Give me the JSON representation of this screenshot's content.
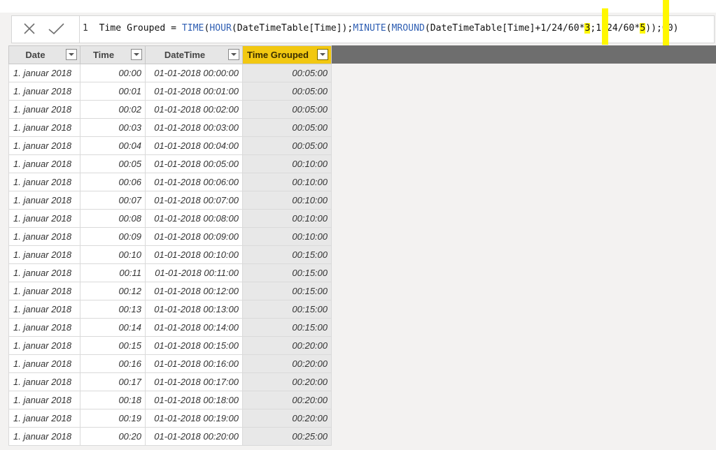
{
  "formula_bar": {
    "cancel_icon": "close-icon",
    "commit_icon": "check-icon",
    "line_number": "1",
    "parts": [
      {
        "text": "  Time Grouped = ",
        "kind": "plain"
      },
      {
        "text": "TIME",
        "kind": "fn"
      },
      {
        "text": "(",
        "kind": "plain"
      },
      {
        "text": "HOUR",
        "kind": "fn"
      },
      {
        "text": "(DateTimeTable[Time]);",
        "kind": "plain"
      },
      {
        "text": "MINUTE",
        "kind": "fn"
      },
      {
        "text": "(",
        "kind": "plain"
      },
      {
        "text": "MROUND",
        "kind": "fn"
      },
      {
        "text": "(DateTimeTable[Time]+1/24/60*",
        "kind": "plain"
      },
      {
        "text": "3",
        "kind": "hl"
      },
      {
        "text": ";1/24/60*",
        "kind": "plain"
      },
      {
        "text": "5",
        "kind": "hl"
      },
      {
        "text": "));00)",
        "kind": "plain"
      }
    ],
    "highlight_color": "#fff700"
  },
  "grid": {
    "columns": [
      {
        "label": "Date",
        "selected": false
      },
      {
        "label": "Time",
        "selected": false
      },
      {
        "label": "DateTime",
        "selected": false
      },
      {
        "label": "Time Grouped",
        "selected": true
      }
    ],
    "selected_color": "#f2c811",
    "rows": [
      [
        "1. januar 2018",
        "00:00",
        "01-01-2018 00:00:00",
        "00:05:00"
      ],
      [
        "1. januar 2018",
        "00:01",
        "01-01-2018 00:01:00",
        "00:05:00"
      ],
      [
        "1. januar 2018",
        "00:02",
        "01-01-2018 00:02:00",
        "00:05:00"
      ],
      [
        "1. januar 2018",
        "00:03",
        "01-01-2018 00:03:00",
        "00:05:00"
      ],
      [
        "1. januar 2018",
        "00:04",
        "01-01-2018 00:04:00",
        "00:05:00"
      ],
      [
        "1. januar 2018",
        "00:05",
        "01-01-2018 00:05:00",
        "00:10:00"
      ],
      [
        "1. januar 2018",
        "00:06",
        "01-01-2018 00:06:00",
        "00:10:00"
      ],
      [
        "1. januar 2018",
        "00:07",
        "01-01-2018 00:07:00",
        "00:10:00"
      ],
      [
        "1. januar 2018",
        "00:08",
        "01-01-2018 00:08:00",
        "00:10:00"
      ],
      [
        "1. januar 2018",
        "00:09",
        "01-01-2018 00:09:00",
        "00:10:00"
      ],
      [
        "1. januar 2018",
        "00:10",
        "01-01-2018 00:10:00",
        "00:15:00"
      ],
      [
        "1. januar 2018",
        "00:11",
        "01-01-2018 00:11:00",
        "00:15:00"
      ],
      [
        "1. januar 2018",
        "00:12",
        "01-01-2018 00:12:00",
        "00:15:00"
      ],
      [
        "1. januar 2018",
        "00:13",
        "01-01-2018 00:13:00",
        "00:15:00"
      ],
      [
        "1. januar 2018",
        "00:14",
        "01-01-2018 00:14:00",
        "00:15:00"
      ],
      [
        "1. januar 2018",
        "00:15",
        "01-01-2018 00:15:00",
        "00:20:00"
      ],
      [
        "1. januar 2018",
        "00:16",
        "01-01-2018 00:16:00",
        "00:20:00"
      ],
      [
        "1. januar 2018",
        "00:17",
        "01-01-2018 00:17:00",
        "00:20:00"
      ],
      [
        "1. januar 2018",
        "00:18",
        "01-01-2018 00:18:00",
        "00:20:00"
      ],
      [
        "1. januar 2018",
        "00:19",
        "01-01-2018 00:19:00",
        "00:20:00"
      ],
      [
        "1. januar 2018",
        "00:20",
        "01-01-2018 00:20:00",
        "00:25:00"
      ]
    ]
  }
}
